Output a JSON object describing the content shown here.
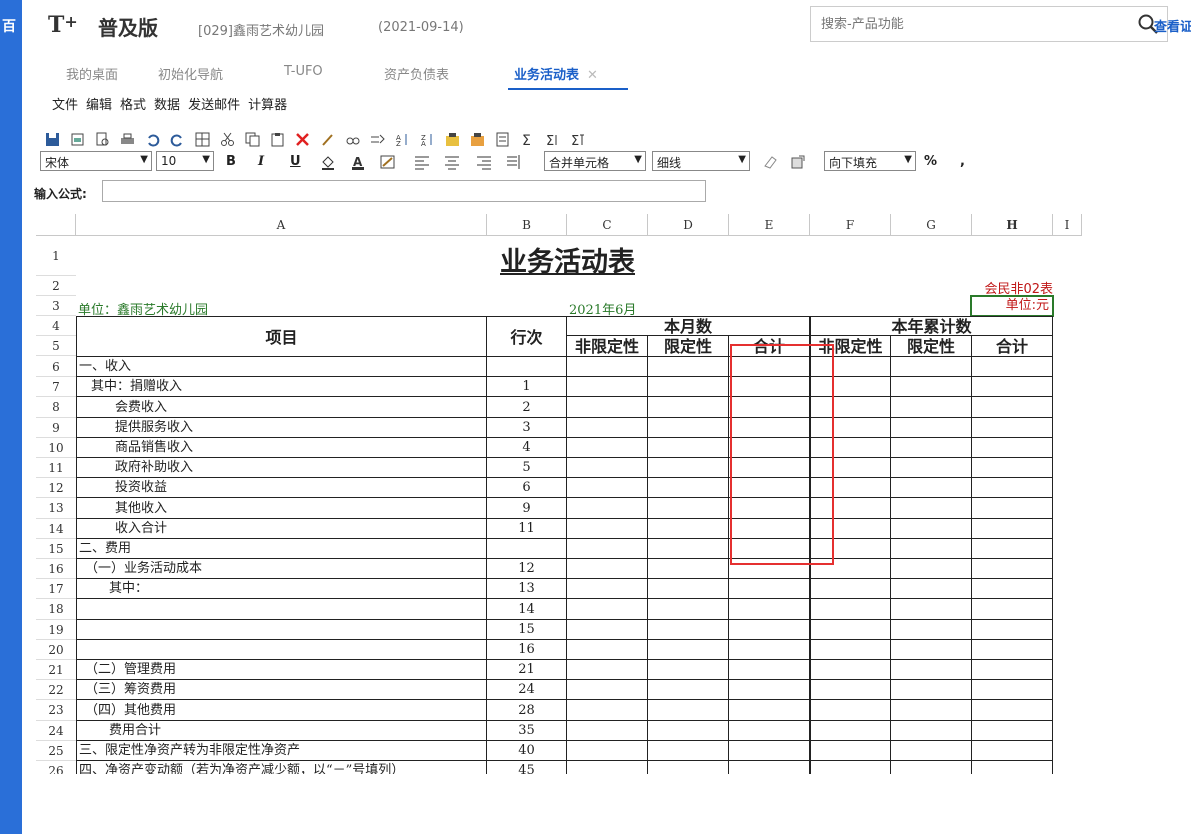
{
  "app": {
    "logo": "T",
    "logo_plus": "+",
    "product": "普及版",
    "company": "[029]鑫雨艺术幼儿园",
    "date": "(2021-09-14)",
    "left_glyph": "百",
    "search_placeholder": "搜索-产品功能",
    "view_link": "查看证"
  },
  "tabs": [
    {
      "label": "我的桌面"
    },
    {
      "label": "初始化导航"
    },
    {
      "label": "T-UFO"
    },
    {
      "label": "资产负债表"
    },
    {
      "label": "业务活动表",
      "close": "✕"
    }
  ],
  "menu": [
    "文件",
    "编辑",
    "格式",
    "数据",
    "发送邮件",
    "计算器"
  ],
  "toolbar": {
    "font": "宋体",
    "size": "10",
    "bold": "B",
    "italic": "I",
    "underline": "U",
    "merge": "合并单元格",
    "border": "细线",
    "fill": "向下填充",
    "percent": "%",
    "comma": ","
  },
  "formula": {
    "label": "输入公式:"
  },
  "columns": [
    "A",
    "B",
    "C",
    "D",
    "E",
    "F",
    "G",
    "H",
    "I"
  ],
  "report": {
    "title": "业务活动表",
    "form_code": "会民非02表",
    "unit_cell": "单位:元",
    "org": "单位：鑫雨艺术幼儿园",
    "period": "2021年6月",
    "h_item": "项目",
    "h_line": "行次",
    "h_month": "本月数",
    "h_year": "本年累计数",
    "h_unrestricted": "非限定性",
    "h_restricted": "限定性",
    "h_total": "合计"
  },
  "rows": [
    {
      "n": "6",
      "item": "一、收入",
      "line": "",
      "indent": 0
    },
    {
      "n": "7",
      "item": "其中：捐赠收入",
      "line": "1",
      "indent": 2
    },
    {
      "n": "8",
      "item": "会费收入",
      "line": "2",
      "indent": 6
    },
    {
      "n": "9",
      "item": "提供服务收入",
      "line": "3",
      "indent": 6
    },
    {
      "n": "10",
      "item": "商品销售收入",
      "line": "4",
      "indent": 6
    },
    {
      "n": "11",
      "item": "政府补助收入",
      "line": "5",
      "indent": 6
    },
    {
      "n": "12",
      "item": "投资收益",
      "line": "6",
      "indent": 6
    },
    {
      "n": "13",
      "item": "其他收入",
      "line": "9",
      "indent": 6
    },
    {
      "n": "14",
      "item": "收入合计",
      "line": "11",
      "indent": 6
    },
    {
      "n": "15",
      "item": "二、费用",
      "line": "",
      "indent": 0
    },
    {
      "n": "16",
      "item": "（一）业务活动成本",
      "line": "12",
      "indent": 1
    },
    {
      "n": "17",
      "item": "其中：",
      "line": "13",
      "indent": 5
    },
    {
      "n": "18",
      "item": "",
      "line": "14",
      "indent": 0
    },
    {
      "n": "19",
      "item": "",
      "line": "15",
      "indent": 0
    },
    {
      "n": "20",
      "item": "",
      "line": "16",
      "indent": 0
    },
    {
      "n": "21",
      "item": "（二）管理费用",
      "line": "21",
      "indent": 1
    },
    {
      "n": "22",
      "item": "（三）筹资费用",
      "line": "24",
      "indent": 1
    },
    {
      "n": "23",
      "item": "（四）其他费用",
      "line": "28",
      "indent": 1
    },
    {
      "n": "24",
      "item": "费用合计",
      "line": "35",
      "indent": 5
    },
    {
      "n": "25",
      "item": "三、限定性净资产转为非限定性净资产",
      "line": "40",
      "indent": 0
    },
    {
      "n": "26",
      "item": "四、净资产变动额（若为净资产减少额，以“－”号填列）",
      "line": "45",
      "indent": 0
    }
  ],
  "top_row_numbers": [
    "1",
    "2",
    "3",
    "4",
    "5"
  ]
}
